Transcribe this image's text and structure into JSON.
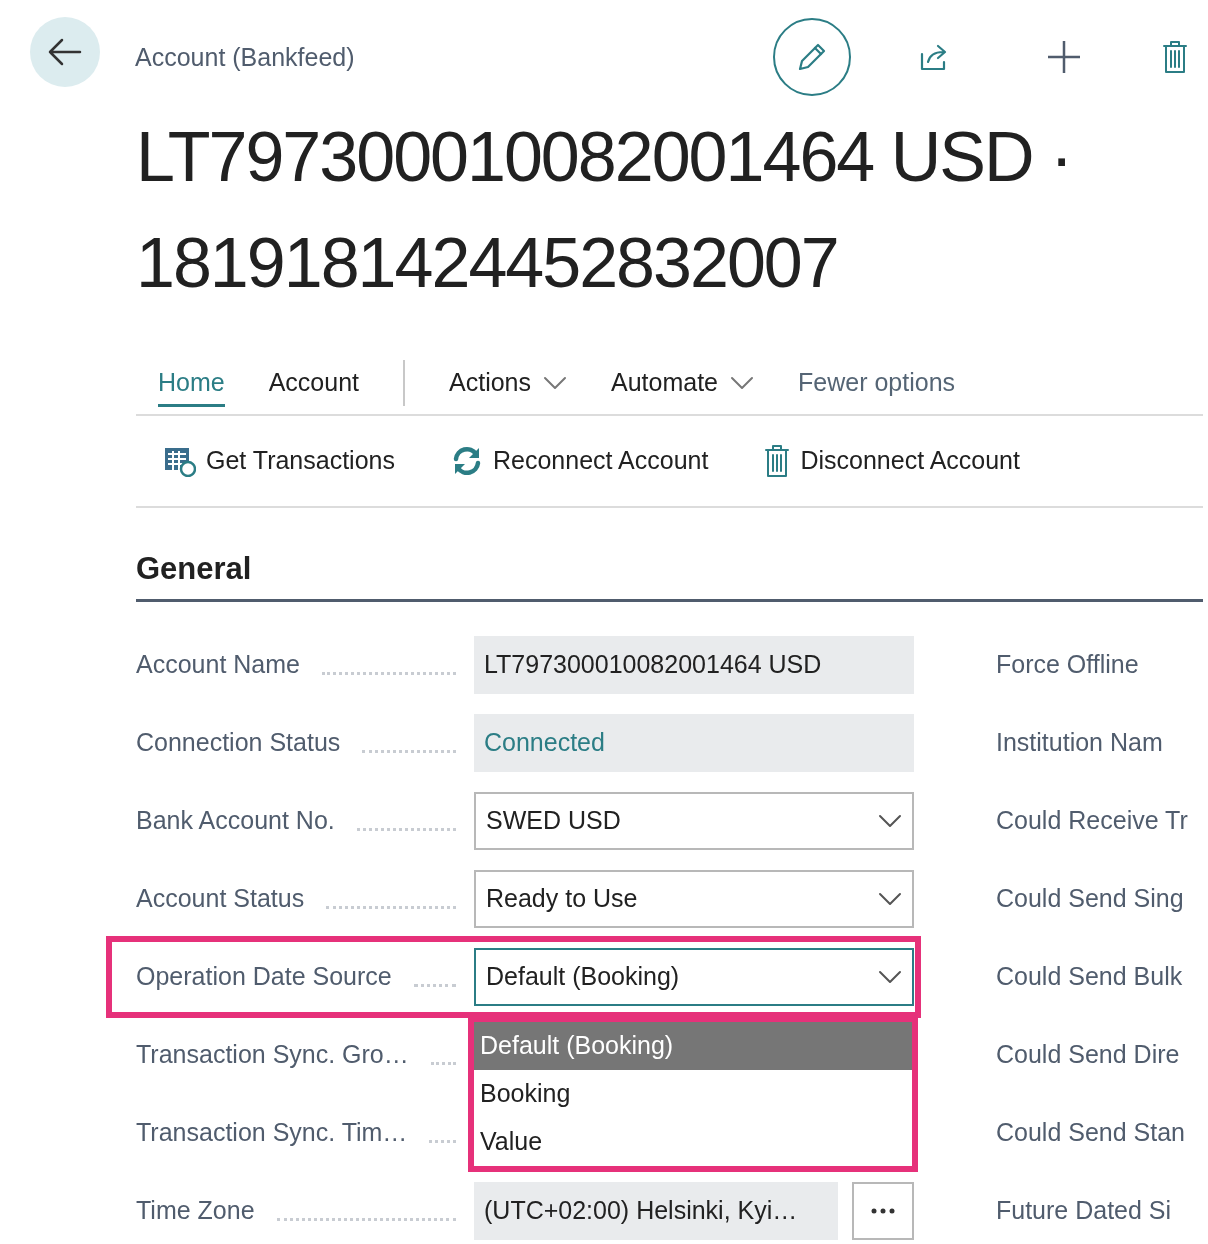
{
  "header": {
    "breadcrumb": "Account (Bankfeed)",
    "title_lines": [
      "LT797300010082001464 USD ·",
      "1819181424452832007"
    ]
  },
  "action_tabs": [
    {
      "label": "Home",
      "kind": "tab",
      "selected": true
    },
    {
      "label": "Account",
      "kind": "tab",
      "selected": false
    },
    {
      "label": "Actions",
      "kind": "menu",
      "selected": false
    },
    {
      "label": "Automate",
      "kind": "menu",
      "selected": false
    },
    {
      "label": "Fewer options",
      "kind": "toggle",
      "selected": false
    }
  ],
  "actions": [
    {
      "label": "Get Transactions"
    },
    {
      "label": "Reconnect Account"
    },
    {
      "label": "Disconnect Account"
    }
  ],
  "section": {
    "title": "General"
  },
  "fields": [
    {
      "label": "Account Name",
      "kind": "readonly",
      "value": "LT797300010082001464 USD"
    },
    {
      "label": "Connection Status",
      "kind": "readonly-link",
      "value": "Connected"
    },
    {
      "label": "Bank Account No.",
      "kind": "dropdown",
      "value": "SWED USD"
    },
    {
      "label": "Account Status",
      "kind": "dropdown",
      "value": "Ready to Use"
    },
    {
      "label": "Operation Date Source",
      "kind": "dropdown",
      "value": "Default (Booking)",
      "highlighted": true,
      "options": [
        {
          "label": "Default (Booking)",
          "selected": true
        },
        {
          "label": "Booking",
          "selected": false
        },
        {
          "label": "Value",
          "selected": false
        }
      ]
    },
    {
      "label": "Transaction Sync. Gro…",
      "kind": "empty"
    },
    {
      "label": "Transaction Sync. Tim…",
      "kind": "empty"
    },
    {
      "label": "Time Zone",
      "kind": "lookup",
      "value": "(UTC+02:00) Helsinki, Kyi…"
    }
  ],
  "right_fields": [
    "Force Offline",
    "Institution Nam",
    "Could Receive Tr",
    "Could Send Sing",
    "Could Send Bulk",
    "Could Send Dire",
    "Could Send Stan",
    "Future Dated Si"
  ]
}
